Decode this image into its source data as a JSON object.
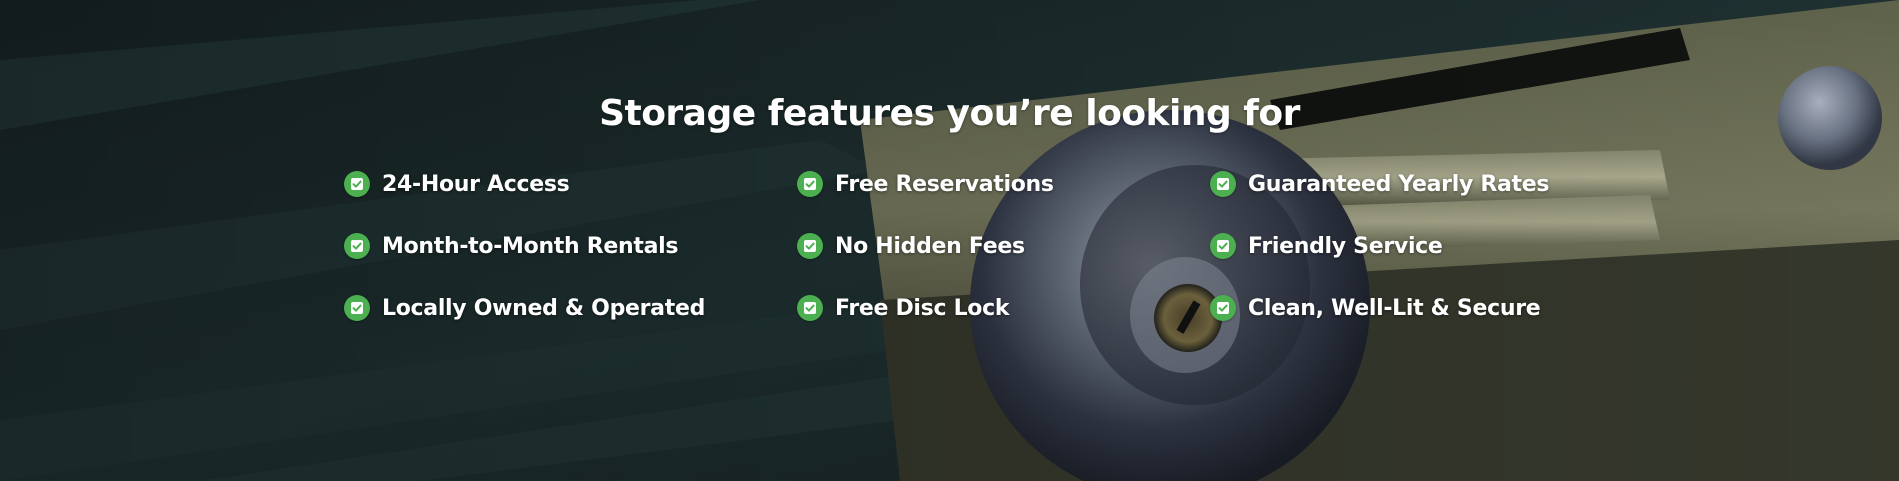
{
  "section": {
    "title": "Storage features you’re looking for"
  },
  "colors": {
    "accent": "#4caf50",
    "text": "#ffffff",
    "background": "#22302f"
  },
  "features": [
    {
      "label": "24-Hour Access",
      "icon": "checkbox-icon"
    },
    {
      "label": "Free Reservations",
      "icon": "checkbox-icon"
    },
    {
      "label": "Guaranteed Yearly Rates",
      "icon": "checkbox-icon"
    },
    {
      "label": "Month-to-Month Rentals",
      "icon": "checkbox-icon"
    },
    {
      "label": "No Hidden Fees",
      "icon": "checkbox-icon"
    },
    {
      "label": "Friendly Service",
      "icon": "checkbox-icon"
    },
    {
      "label": "Locally Owned & Operated",
      "icon": "checkbox-icon"
    },
    {
      "label": "Free Disc Lock",
      "icon": "checkbox-icon"
    },
    {
      "label": "Clean, Well-Lit & Secure",
      "icon": "checkbox-icon"
    }
  ]
}
